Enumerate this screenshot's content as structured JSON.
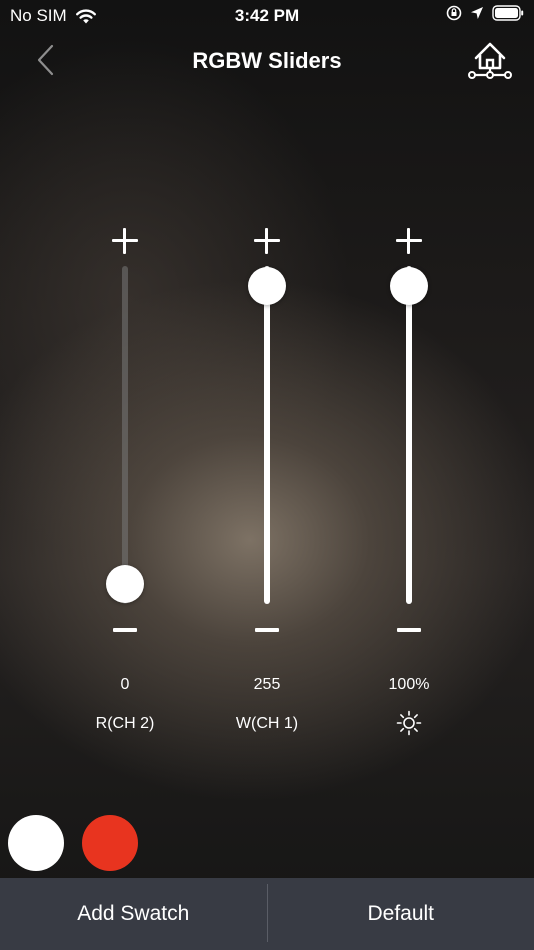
{
  "status_bar": {
    "carrier": "No SIM",
    "time": "3:42 PM",
    "icons": [
      "wifi-icon",
      "orientation-lock-icon",
      "location-arrow-icon",
      "battery-icon"
    ]
  },
  "nav": {
    "title": "RGBW Sliders",
    "back_icon": "chevron-left-icon",
    "home_icon": "home-network-icon"
  },
  "sliders": [
    {
      "id": "red",
      "value_text": "0",
      "label": "R(CH 2)",
      "level": 0.0
    },
    {
      "id": "white",
      "value_text": "255",
      "label": "W(CH 1)",
      "level": 1.0
    },
    {
      "id": "brightness",
      "value_text": "100%",
      "label": "",
      "label_icon": "sun-icon",
      "level": 1.0
    }
  ],
  "swatches": [
    {
      "name": "white",
      "color": "#ffffff"
    },
    {
      "name": "red",
      "color": "#e8341f"
    }
  ],
  "bottom_bar": {
    "add_swatch": "Add Swatch",
    "default": "Default"
  }
}
